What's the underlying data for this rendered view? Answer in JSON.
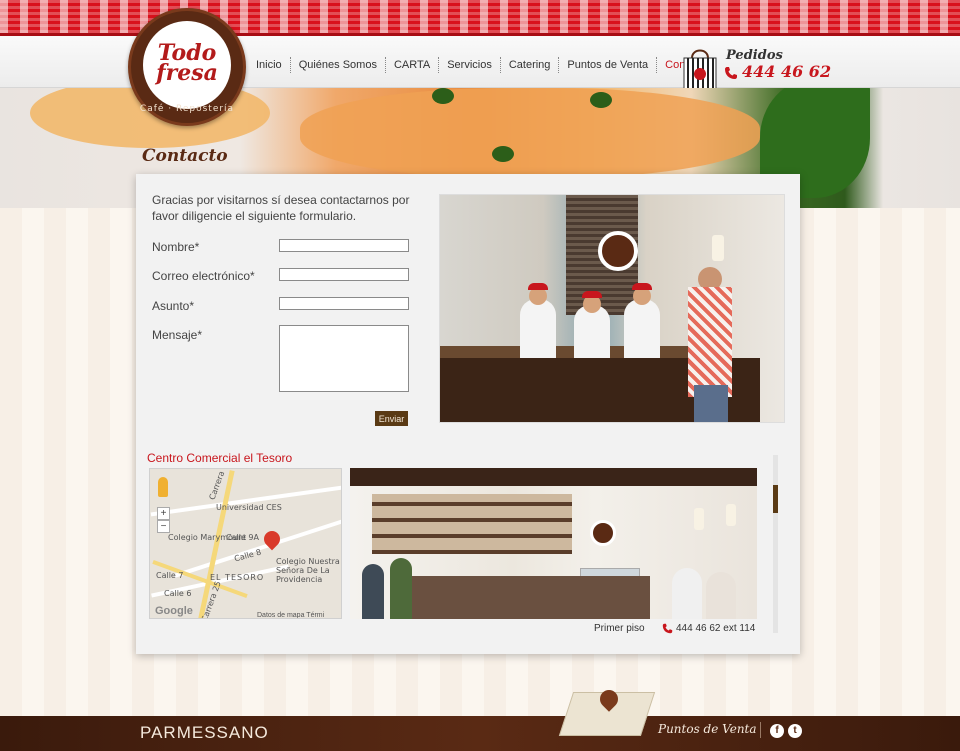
{
  "header": {
    "logo_title": "Todo fresa",
    "logo_subtitle": "Café · Repostería",
    "nav": [
      {
        "label": "Inicio"
      },
      {
        "label": "Quiénes Somos"
      },
      {
        "label": "CARTA"
      },
      {
        "label": "Servicios"
      },
      {
        "label": "Catering"
      },
      {
        "label": "Puntos de Venta"
      },
      {
        "label": "Contacto"
      }
    ],
    "active_nav": "Contacto",
    "pedidos_label": "Pedidos",
    "pedidos_phone": "444 46 62"
  },
  "page": {
    "heading": "Contacto"
  },
  "form": {
    "intro": "Gracias por visitarnos sí desea contactarnos por favor diligencie el siguiente formulario.",
    "fields": [
      {
        "label": "Nombre*",
        "value": ""
      },
      {
        "label": "Correo electrónico*",
        "value": ""
      },
      {
        "label": "Asunto*",
        "value": ""
      },
      {
        "label": "Mensaje*",
        "value": ""
      }
    ],
    "submit_label": "Enviar"
  },
  "location": {
    "title": "Centro Comercial el Tesoro",
    "floor": "Primer piso",
    "phone": "444 46 62 ext 114",
    "map": {
      "labels": {
        "universidad": "Universidad CES",
        "colegio_marymount": "Colegio Marymount",
        "colegio_providencia": "Colegio Nuestra Señora De La Providencia",
        "el_tesoro": "EL TESORO",
        "carrera_25": "Carrera 25",
        "carrera_top": "Carrera",
        "calle_9a": "Calle 9A",
        "calle_8": "Calle 8",
        "calle_7": "Calle 7",
        "calle_6": "Calle 6"
      },
      "zoom_in": "+",
      "zoom_out": "−",
      "google": "Google",
      "terms": "Datos de mapa   Térmi"
    }
  },
  "footer": {
    "brand": "PARMESSANO",
    "puntos_label": "Puntos de Venta",
    "social": [
      "facebook-icon",
      "twitter-icon"
    ]
  },
  "colors": {
    "brand_red": "#c8161d",
    "brand_brown": "#5a2a14",
    "panel_bg": "#f2f2f2"
  }
}
